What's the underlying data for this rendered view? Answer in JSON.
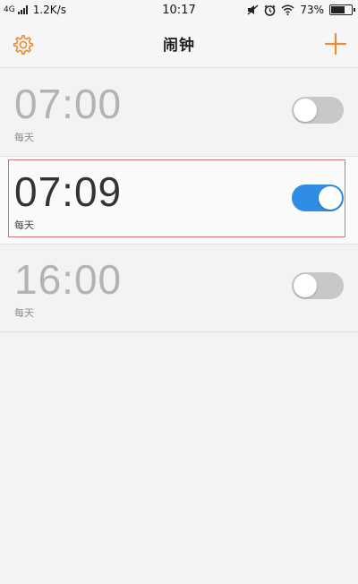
{
  "status_bar": {
    "network": "4G",
    "speed": "1.2K/s",
    "time": "10:17",
    "battery": "73%",
    "battery_level": 0.73
  },
  "header": {
    "title": "闹钟",
    "settings_icon": "gear-icon",
    "add_icon": "plus-icon",
    "accent_color": "#ee8a36"
  },
  "alarms": [
    {
      "time": "07:00",
      "repeat": "每天",
      "enabled": false
    },
    {
      "time": "07:09",
      "repeat": "每天",
      "enabled": true
    },
    {
      "time": "16:00",
      "repeat": "每天",
      "enabled": false
    }
  ],
  "colors": {
    "toggle_on": "#2f8de4",
    "toggle_off": "#c8c8c8",
    "highlight_border": "#d9727a"
  }
}
